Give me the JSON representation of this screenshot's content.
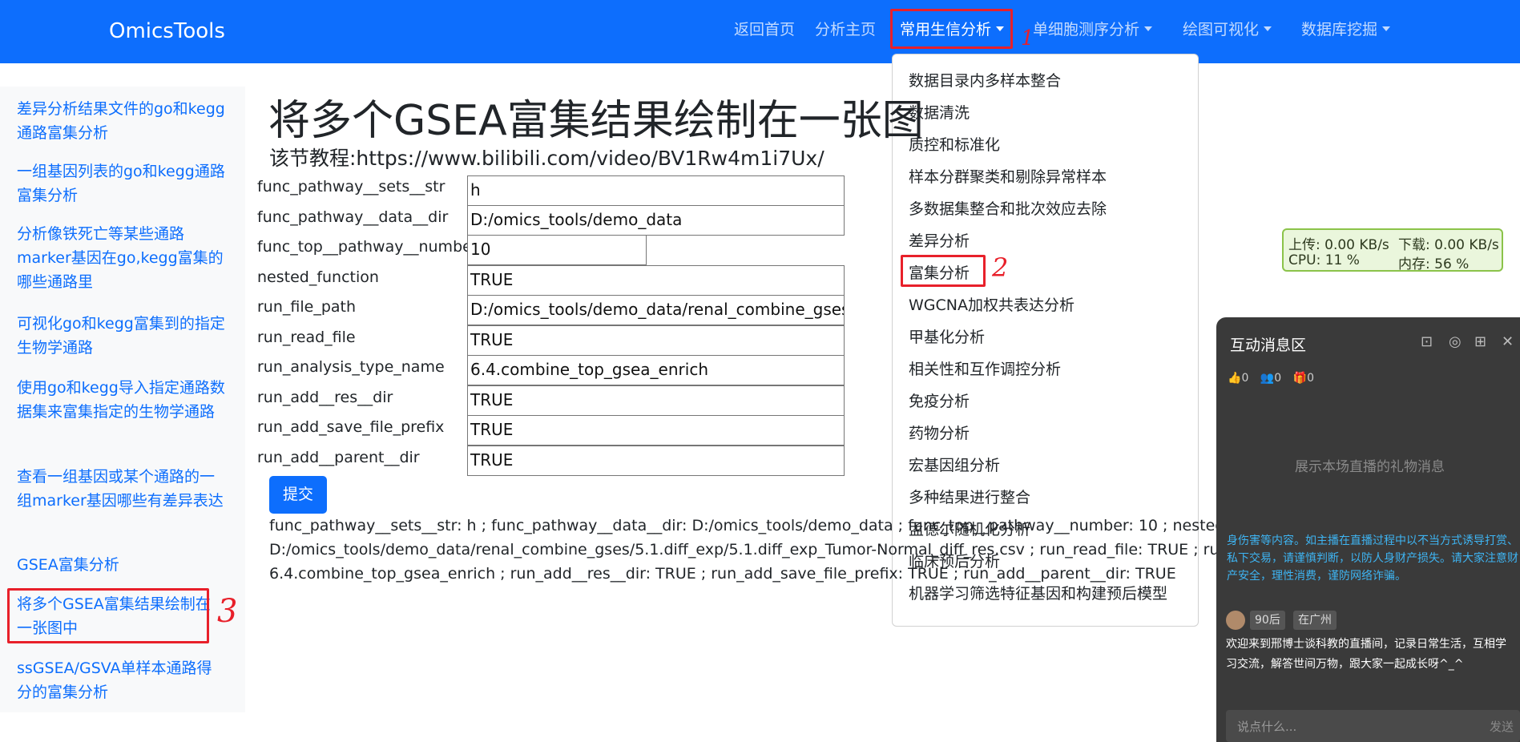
{
  "navbar": {
    "brand": "OmicsTools",
    "links": [
      "返回首页",
      "分析主页",
      "常用生信分析",
      "单细胞测序分析",
      "绘图可视化",
      "数据库挖掘"
    ]
  },
  "dropdown": {
    "items": [
      "数据目录内多样本整合",
      "数据清洗",
      "质控和标准化",
      "样本分群聚类和剔除异常样本",
      "多数据集整合和批次效应去除",
      "差异分析",
      "富集分析",
      "WGCNA加权共表达分析",
      "甲基化分析",
      "相关性和互作调控分析",
      "免疫分析",
      "药物分析",
      "宏基因组分析",
      "多种结果进行整合",
      "孟德尔随机化分析",
      "临床预后分析",
      "机器学习筛选特征基因和构建预后模型"
    ]
  },
  "annotations": [
    "1",
    "2",
    "3"
  ],
  "sidebar": {
    "items": [
      "差异分析结果文件的go和kegg通路富集分析",
      "一组基因列表的go和kegg通路富集分析",
      "分析像铁死亡等某些通路marker基因在go,kegg富集的哪些通路里",
      "可视化go和kegg富集到的指定生物学通路",
      "使用go和kegg导入指定通路数据集来富集指定的生物学通路",
      "查看一组基因或某个通路的一组marker基因哪些有差异表达",
      "GSEA富集分析",
      "将多个GSEA富集结果绘制在一张图中",
      "ssGSEA/GSVA单样本通路得分的富集分析"
    ]
  },
  "main": {
    "title": "将多个GSEA富集结果绘制在一张图",
    "tutorial": "该节教程:https://www.bilibili.com/video/BV1Rw4m1i7Ux/",
    "fields": [
      {
        "label": "func_pathway__sets__str",
        "value": "h"
      },
      {
        "label": "func_pathway__data__dir",
        "value": "D:/omics_tools/demo_data"
      },
      {
        "label": "func_top__pathway__number",
        "value": "10"
      },
      {
        "label": "nested_function",
        "value": "TRUE"
      },
      {
        "label": "run_file_path",
        "value": "D:/omics_tools/demo_data/renal_combine_gses/"
      },
      {
        "label": "run_read_file",
        "value": "TRUE"
      },
      {
        "label": "run_analysis_type_name",
        "value": "6.4.combine_top_gsea_enrich"
      },
      {
        "label": "run_add__res__dir",
        "value": "TRUE"
      },
      {
        "label": "run_add_save_file_prefix",
        "value": "TRUE"
      },
      {
        "label": "run_add__parent__dir",
        "value": "TRUE"
      }
    ],
    "submit": "提交",
    "result_lines": [
      "func_pathway__sets__str: h ; func_pathway__data__dir: D:/omics_tools/demo_data ; func_top__pathway__number: 10 ; nested_function: TRUE ; run_file_path:",
      "D:/omics_tools/demo_data/renal_combine_gses/5.1.diff_exp/5.1.diff_exp_Tumor-Normal_diff_res.csv ; run_read_file: TRUE ; run_analysis_type_name:",
      "6.4.combine_top_gsea_enrich ; run_add__res__dir: TRUE ; run_add_save_file_prefix: TRUE ; run_add__parent__dir: TRUE"
    ]
  },
  "net_widget": {
    "upload": "上传: 0.00 KB/s",
    "download": "下载: 0.00 KB/s",
    "cpu": "CPU: 11 %",
    "mem": "内存: 56 %"
  },
  "chat": {
    "title": "互动消息区",
    "likes": "0",
    "users": "0",
    "gifts": "0",
    "empty": "展示本场直播的礼物消息",
    "warning": "身伤害等内容。如主播在直播过程中以不当方式诱导打赏、私下交易，请谨慎判断，以防人身财产损失。请大家注意财产安全，理性消费，谨防网络诈骗。",
    "tag_age": "90后",
    "tag_city": "在广州",
    "welcome": "欢迎来到邢博士谈科教的直播间，记录日常生活，互相学习交流，解答世间万物，跟大家一起成长呀^_^",
    "placeholder": "说点什么...",
    "send": "发送"
  }
}
